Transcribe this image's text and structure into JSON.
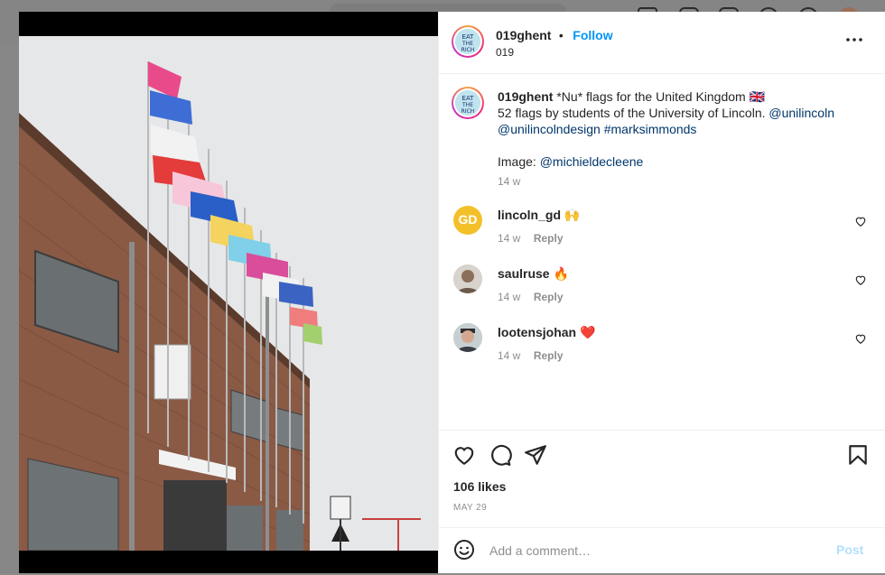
{
  "post": {
    "username": "019ghent",
    "follow_label": "Follow",
    "separator": "•",
    "subtitle": "019",
    "caption": {
      "username": "019ghent",
      "line1": "*Nu* flags for the United Kingdom 🇬🇧",
      "line2_prefix": "52 flags by students of the University of Lincoln.",
      "mention1": "@unilincoln",
      "mention2": "@unilincolndesign",
      "hashtag": "#marksimmonds",
      "image_prefix": "Image:",
      "image_mention": "@michieldecleene",
      "time": "14 w"
    },
    "comments": [
      {
        "username": "lincoln_gd",
        "text": "🙌",
        "time": "14 w",
        "reply": "Reply",
        "avatar_text": "GD",
        "avatar_color": "#f3c02a"
      },
      {
        "username": "saulruse",
        "text": "🔥",
        "time": "14 w",
        "reply": "Reply"
      },
      {
        "username": "lootensjohan",
        "text": "❤️",
        "time": "14 w",
        "reply": "Reply"
      }
    ],
    "likes": "106 likes",
    "date": "MAY 29",
    "comment_placeholder": "Add a comment…",
    "post_label": "Post"
  },
  "icons": {
    "more": "more-options-icon",
    "like": "heart-icon",
    "comment": "comment-icon",
    "share": "share-icon",
    "save": "bookmark-icon",
    "emoji": "emoji-icon"
  },
  "colors": {
    "accent": "#0095f6",
    "link": "#00376b",
    "post_disabled": "#b2dffc",
    "meta": "#8e8e8e"
  }
}
